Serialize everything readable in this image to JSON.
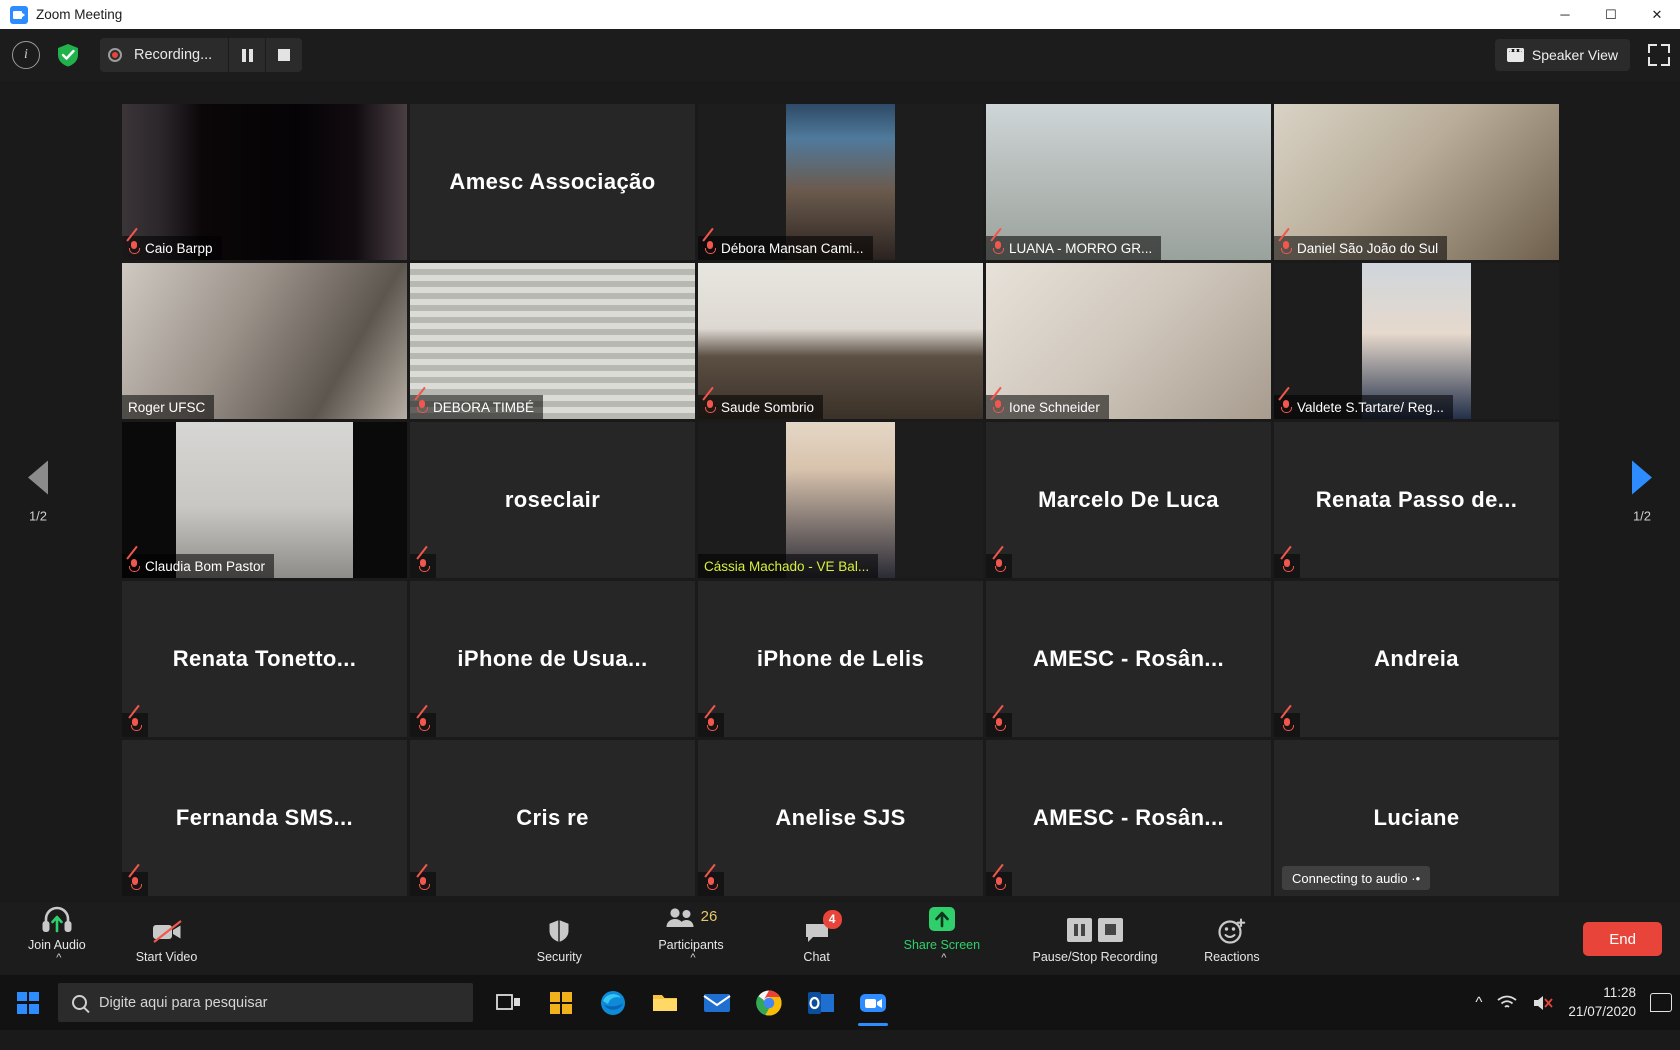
{
  "window": {
    "title": "Zoom Meeting",
    "minimize": "─",
    "maximize": "☐",
    "close": "✕"
  },
  "topbar": {
    "info_icon": "i",
    "shield_icon": "shield-check-icon",
    "recording_label": "Recording...",
    "pause_recording_icon": "pause-icon",
    "stop_recording_icon": "stop-icon",
    "speaker_view_label": "Speaker View",
    "fullscreen_icon": "fullscreen-icon"
  },
  "gallery": {
    "prev_page_label": "1/2",
    "next_page_label": "1/2",
    "active_border_color": "#d7f03c",
    "tiles": [
      {
        "name": "Caio Barpp",
        "video": true,
        "muted": true,
        "style": "dark-room",
        "active": false
      },
      {
        "name": "Amesc Associação",
        "video": false,
        "muted": false,
        "style": "",
        "active": false
      },
      {
        "name": "Débora Mansan Cami...",
        "video": true,
        "muted": true,
        "style": "portrait-amesc",
        "active": false
      },
      {
        "name": "LUANA - MORRO GR...",
        "video": true,
        "muted": true,
        "style": "office-mask",
        "active": false
      },
      {
        "name": "Daniel São João do Sul",
        "video": true,
        "muted": true,
        "style": "man-office",
        "active": false
      },
      {
        "name": "Roger UFSC",
        "video": true,
        "muted": false,
        "style": "man-home",
        "active": false
      },
      {
        "name": "DEBORA TIMBÉ",
        "video": true,
        "muted": true,
        "style": "blinds",
        "active": false
      },
      {
        "name": "Saude Sombrio",
        "video": true,
        "muted": true,
        "style": "whiteboard",
        "active": false
      },
      {
        "name": "Ione Schneider",
        "video": true,
        "muted": true,
        "style": "woman-room",
        "active": false
      },
      {
        "name": "Valdete S.Tartare/ Reg...",
        "video": true,
        "muted": true,
        "style": "portrait-blue",
        "active": false
      },
      {
        "name": "Claudia Bom Pastor",
        "video": true,
        "muted": true,
        "style": "pillar-cam",
        "active": false
      },
      {
        "name": "roseclair",
        "video": false,
        "muted": true,
        "style": "",
        "active": false
      },
      {
        "name": "Cássia Machado - VE Bal...",
        "video": true,
        "muted": false,
        "style": "portrait-dark",
        "active": true
      },
      {
        "name": "Marcelo De Luca",
        "video": false,
        "muted": true,
        "style": "",
        "active": false
      },
      {
        "name": "Renata Passo de...",
        "video": false,
        "muted": true,
        "style": "",
        "active": false
      },
      {
        "name": "Renata  Tonetto...",
        "video": false,
        "muted": true,
        "style": "",
        "active": false
      },
      {
        "name": "iPhone de Usua...",
        "video": false,
        "muted": true,
        "style": "",
        "active": false
      },
      {
        "name": "iPhone de Lelis",
        "video": false,
        "muted": true,
        "style": "",
        "active": false
      },
      {
        "name": "AMESC - Rosân...",
        "video": false,
        "muted": true,
        "style": "",
        "active": false
      },
      {
        "name": "Andreia",
        "video": false,
        "muted": true,
        "style": "",
        "active": false
      },
      {
        "name": "Fernanda SMS...",
        "video": false,
        "muted": true,
        "style": "",
        "active": false
      },
      {
        "name": "Cris re",
        "video": false,
        "muted": true,
        "style": "",
        "active": false
      },
      {
        "name": "Anelise SJS",
        "video": false,
        "muted": true,
        "style": "",
        "active": false
      },
      {
        "name": "AMESC - Rosân...",
        "video": false,
        "muted": true,
        "style": "",
        "active": false
      },
      {
        "name": "Luciane",
        "video": false,
        "muted": false,
        "style": "",
        "active": false,
        "status": "Connecting to audio ·•"
      }
    ]
  },
  "toolbar": {
    "join_audio_label": "Join Audio",
    "join_audio_icon": "headset-arrow-icon",
    "start_video_label": "Start Video",
    "start_video_icon": "camera-off-icon",
    "security_label": "Security",
    "security_icon": "shield-icon",
    "participants_label": "Participants",
    "participants_icon": "people-icon",
    "participants_count": "26",
    "chat_label": "Chat",
    "chat_icon": "chat-bubble-icon",
    "chat_badge": "4",
    "share_screen_label": "Share Screen",
    "share_screen_icon": "share-up-arrow-icon",
    "share_screen_color": "#2fd06b",
    "recording_label": "Pause/Stop Recording",
    "recording_pause_icon": "pause-icon",
    "recording_stop_icon": "stop-icon",
    "reactions_label": "Reactions",
    "reactions_icon": "smiley-plus-icon",
    "end_label": "End",
    "end_color": "#e8443a",
    "caret_icon": "chevron-up-icon"
  },
  "taskbar": {
    "start_icon": "windows-logo-icon",
    "search_placeholder": "Digite aqui para pesquisar",
    "search_icon": "search-icon",
    "apps": [
      {
        "name": "task-view-icon"
      },
      {
        "name": "microsoft-store-icon"
      },
      {
        "name": "microsoft-edge-icon"
      },
      {
        "name": "file-explorer-icon"
      },
      {
        "name": "mail-icon"
      },
      {
        "name": "google-chrome-icon"
      },
      {
        "name": "outlook-icon"
      },
      {
        "name": "zoom-icon"
      }
    ],
    "tray": {
      "chevron_icon": "show-hidden-icons-icon",
      "network_icon": "wifi-icon",
      "volume_icon": "volume-muted-icon",
      "time": "11:28",
      "date": "21/07/2020",
      "action_center_icon": "notifications-icon"
    }
  }
}
